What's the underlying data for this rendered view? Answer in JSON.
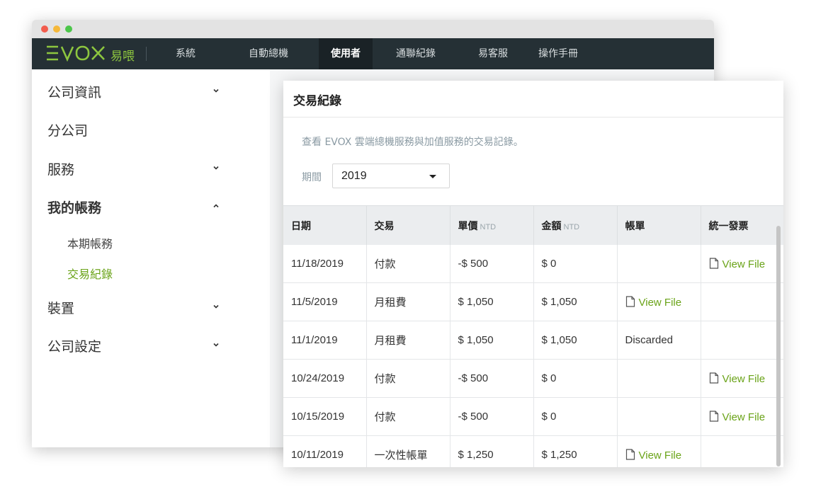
{
  "app": {
    "logo_text": "EVOX",
    "logo_cn": "易喂"
  },
  "nav": {
    "items": [
      {
        "label": "系統"
      },
      {
        "label": "自動總機"
      },
      {
        "label": "使用者",
        "active": true
      },
      {
        "label": "通聯紀錄"
      },
      {
        "label": "易客服"
      },
      {
        "label": "操作手冊"
      }
    ]
  },
  "sidebar": {
    "items": [
      {
        "label": "公司資訊",
        "chevron": "chevron-down-icon"
      },
      {
        "label": "分公司"
      },
      {
        "label": "服務",
        "chevron": "chevron-down-icon"
      },
      {
        "label": "我的帳務",
        "chevron": "chevron-up-icon",
        "expanded": true
      },
      {
        "label": "裝置",
        "chevron": "chevron-down-icon"
      },
      {
        "label": "公司設定",
        "chevron": "chevron-down-icon"
      }
    ],
    "sub_items": [
      {
        "label": "本期帳務"
      },
      {
        "label": "交易紀錄",
        "active": true
      }
    ]
  },
  "panel": {
    "title": "交易紀錄",
    "description": "查看 EVOX 雲端總機服務與加值服務的交易記錄。",
    "period_label": "期間",
    "period_value": "2019"
  },
  "table": {
    "columns": [
      {
        "label": "日期",
        "unit": ""
      },
      {
        "label": "交易",
        "unit": ""
      },
      {
        "label": "單價",
        "unit": "NTD"
      },
      {
        "label": "金額",
        "unit": "NTD"
      },
      {
        "label": "帳單",
        "unit": ""
      },
      {
        "label": "統一發票",
        "unit": ""
      }
    ],
    "rows": [
      {
        "date": "11/18/2019",
        "type": "付款",
        "unit_price": "-$ 500",
        "amount": "$ 0",
        "bill": "",
        "invoice": "View File"
      },
      {
        "date": "11/5/2019",
        "type": "月租費",
        "unit_price": "$ 1,050",
        "amount": "$ 1,050",
        "bill": "View File",
        "invoice": ""
      },
      {
        "date": "11/1/2019",
        "type": "月租費",
        "unit_price": "$ 1,050",
        "amount": "$ 1,050",
        "bill": "Discarded",
        "invoice": ""
      },
      {
        "date": "10/24/2019",
        "type": "付款",
        "unit_price": "-$ 500",
        "amount": "$ 0",
        "bill": "",
        "invoice": "View File"
      },
      {
        "date": "10/15/2019",
        "type": "付款",
        "unit_price": "-$ 500",
        "amount": "$ 0",
        "bill": "",
        "invoice": "View File"
      },
      {
        "date": "10/11/2019",
        "type": "一次性帳單",
        "unit_price": "$ 1,250",
        "amount": "$ 1,250",
        "bill": "View File",
        "invoice": ""
      }
    ]
  },
  "colors": {
    "nav_bg": "#253035",
    "accent_green": "#6aa318",
    "logo_green": "#8dc63f"
  }
}
